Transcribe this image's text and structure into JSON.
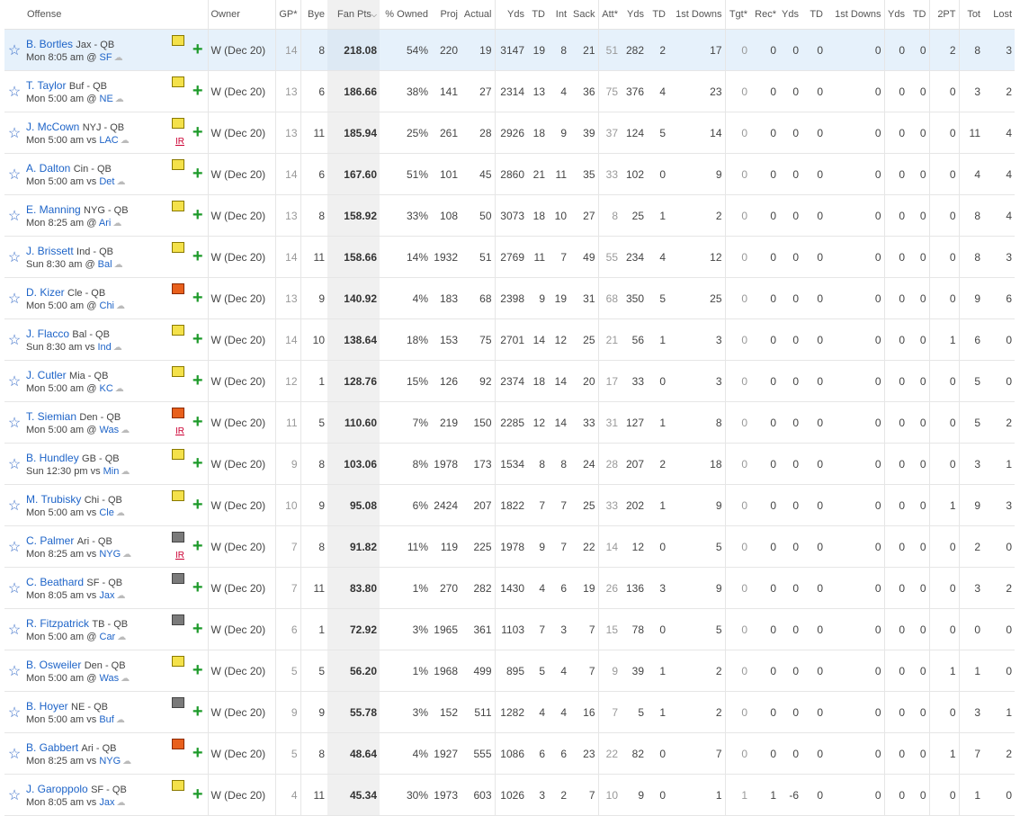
{
  "headers": {
    "offense": "Offense",
    "owner": "Owner",
    "gp": "GP*",
    "bye": "Bye",
    "fan_pts": "Fan Pts",
    "owned": "% Owned",
    "proj": "Proj",
    "actual": "Actual",
    "pass_yds": "Yds",
    "pass_td": "TD",
    "int": "Int",
    "sack": "Sack",
    "rush_att": "Att*",
    "rush_yds": "Yds",
    "rush_td": "TD",
    "rush_1st": "1st Downs",
    "tgt": "Tgt*",
    "rec": "Rec*",
    "rec_yds": "Yds",
    "rec_td": "TD",
    "rec_1st": "1st Downs",
    "ret_yds": "Yds",
    "ret_td": "TD",
    "two_pt": "2PT",
    "fum_tot": "Tot",
    "fum_lost": "Lost"
  },
  "players": [
    {
      "name": "B. Bortles",
      "team": "Jax - QB",
      "time": "Mon 8:05 am",
      "at": "@",
      "opp": "SF",
      "note": "yellow",
      "ir": "",
      "owner": "W (Dec 20)",
      "gp": "14",
      "bye": "8",
      "pts": "218.08",
      "owned": "54%",
      "proj": "220",
      "actual": "19",
      "s": [
        "3147",
        "19",
        "8",
        "21",
        "51",
        "282",
        "2",
        "17",
        "0",
        "0",
        "0",
        "0",
        "0",
        "0",
        "0",
        "2",
        "8",
        "3"
      ]
    },
    {
      "name": "T. Taylor",
      "team": "Buf - QB",
      "time": "Mon 5:00 am",
      "at": "@",
      "opp": "NE",
      "note": "yellow",
      "ir": "",
      "owner": "W (Dec 20)",
      "gp": "13",
      "bye": "6",
      "pts": "186.66",
      "owned": "38%",
      "proj": "141",
      "actual": "27",
      "s": [
        "2314",
        "13",
        "4",
        "36",
        "75",
        "376",
        "4",
        "23",
        "0",
        "0",
        "0",
        "0",
        "0",
        "0",
        "0",
        "0",
        "3",
        "2"
      ]
    },
    {
      "name": "J. McCown",
      "team": "NYJ - QB",
      "time": "Mon 5:00 am",
      "at": "vs",
      "opp": "LAC",
      "note": "yellow",
      "ir": "IR",
      "owner": "W (Dec 20)",
      "gp": "13",
      "bye": "11",
      "pts": "185.94",
      "owned": "25%",
      "proj": "261",
      "actual": "28",
      "s": [
        "2926",
        "18",
        "9",
        "39",
        "37",
        "124",
        "5",
        "14",
        "0",
        "0",
        "0",
        "0",
        "0",
        "0",
        "0",
        "0",
        "11",
        "4"
      ]
    },
    {
      "name": "A. Dalton",
      "team": "Cin - QB",
      "time": "Mon 5:00 am",
      "at": "vs",
      "opp": "Det",
      "note": "yellow",
      "ir": "",
      "owner": "W (Dec 20)",
      "gp": "14",
      "bye": "6",
      "pts": "167.60",
      "owned": "51%",
      "proj": "101",
      "actual": "45",
      "s": [
        "2860",
        "21",
        "11",
        "35",
        "33",
        "102",
        "0",
        "9",
        "0",
        "0",
        "0",
        "0",
        "0",
        "0",
        "0",
        "0",
        "4",
        "4"
      ]
    },
    {
      "name": "E. Manning",
      "team": "NYG - QB",
      "time": "Mon 8:25 am",
      "at": "@",
      "opp": "Ari",
      "note": "yellow",
      "ir": "",
      "owner": "W (Dec 20)",
      "gp": "13",
      "bye": "8",
      "pts": "158.92",
      "owned": "33%",
      "proj": "108",
      "actual": "50",
      "s": [
        "3073",
        "18",
        "10",
        "27",
        "8",
        "25",
        "1",
        "2",
        "0",
        "0",
        "0",
        "0",
        "0",
        "0",
        "0",
        "0",
        "8",
        "4"
      ]
    },
    {
      "name": "J. Brissett",
      "team": "Ind - QB",
      "time": "Sun 8:30 am",
      "at": "@",
      "opp": "Bal",
      "note": "yellow",
      "ir": "",
      "owner": "W (Dec 20)",
      "gp": "14",
      "bye": "11",
      "pts": "158.66",
      "owned": "14%",
      "proj": "1932",
      "actual": "51",
      "s": [
        "2769",
        "11",
        "7",
        "49",
        "55",
        "234",
        "4",
        "12",
        "0",
        "0",
        "0",
        "0",
        "0",
        "0",
        "0",
        "0",
        "8",
        "3"
      ]
    },
    {
      "name": "D. Kizer",
      "team": "Cle - QB",
      "time": "Mon 5:00 am",
      "at": "@",
      "opp": "Chi",
      "note": "red",
      "ir": "",
      "owner": "W (Dec 20)",
      "gp": "13",
      "bye": "9",
      "pts": "140.92",
      "owned": "4%",
      "proj": "183",
      "actual": "68",
      "s": [
        "2398",
        "9",
        "19",
        "31",
        "68",
        "350",
        "5",
        "25",
        "0",
        "0",
        "0",
        "0",
        "0",
        "0",
        "0",
        "0",
        "9",
        "6"
      ]
    },
    {
      "name": "J. Flacco",
      "team": "Bal - QB",
      "time": "Sun 8:30 am",
      "at": "vs",
      "opp": "Ind",
      "note": "yellow",
      "ir": "",
      "owner": "W (Dec 20)",
      "gp": "14",
      "bye": "10",
      "pts": "138.64",
      "owned": "18%",
      "proj": "153",
      "actual": "75",
      "s": [
        "2701",
        "14",
        "12",
        "25",
        "21",
        "56",
        "1",
        "3",
        "0",
        "0",
        "0",
        "0",
        "0",
        "0",
        "0",
        "1",
        "6",
        "0"
      ]
    },
    {
      "name": "J. Cutler",
      "team": "Mia - QB",
      "time": "Mon 5:00 am",
      "at": "@",
      "opp": "KC",
      "note": "yellow",
      "ir": "",
      "owner": "W (Dec 20)",
      "gp": "12",
      "bye": "1",
      "pts": "128.76",
      "owned": "15%",
      "proj": "126",
      "actual": "92",
      "s": [
        "2374",
        "18",
        "14",
        "20",
        "17",
        "33",
        "0",
        "3",
        "0",
        "0",
        "0",
        "0",
        "0",
        "0",
        "0",
        "0",
        "5",
        "0"
      ]
    },
    {
      "name": "T. Siemian",
      "team": "Den - QB",
      "time": "Mon 5:00 am",
      "at": "@",
      "opp": "Was",
      "note": "red",
      "ir": "IR",
      "owner": "W (Dec 20)",
      "gp": "11",
      "bye": "5",
      "pts": "110.60",
      "owned": "7%",
      "proj": "219",
      "actual": "150",
      "s": [
        "2285",
        "12",
        "14",
        "33",
        "31",
        "127",
        "1",
        "8",
        "0",
        "0",
        "0",
        "0",
        "0",
        "0",
        "0",
        "0",
        "5",
        "2"
      ]
    },
    {
      "name": "B. Hundley",
      "team": "GB - QB",
      "time": "Sun 12:30 pm",
      "at": "vs",
      "opp": "Min",
      "note": "yellow",
      "ir": "",
      "owner": "W (Dec 20)",
      "gp": "9",
      "bye": "8",
      "pts": "103.06",
      "owned": "8%",
      "proj": "1978",
      "actual": "173",
      "s": [
        "1534",
        "8",
        "8",
        "24",
        "28",
        "207",
        "2",
        "18",
        "0",
        "0",
        "0",
        "0",
        "0",
        "0",
        "0",
        "0",
        "3",
        "1"
      ]
    },
    {
      "name": "M. Trubisky",
      "team": "Chi - QB",
      "time": "Mon 5:00 am",
      "at": "vs",
      "opp": "Cle",
      "note": "yellow",
      "ir": "",
      "owner": "W (Dec 20)",
      "gp": "10",
      "bye": "9",
      "pts": "95.08",
      "owned": "6%",
      "proj": "2424",
      "actual": "207",
      "s": [
        "1822",
        "7",
        "7",
        "25",
        "33",
        "202",
        "1",
        "9",
        "0",
        "0",
        "0",
        "0",
        "0",
        "0",
        "0",
        "1",
        "9",
        "3"
      ]
    },
    {
      "name": "C. Palmer",
      "team": "Ari - QB",
      "time": "Mon 8:25 am",
      "at": "vs",
      "opp": "NYG",
      "note": "grey",
      "ir": "IR",
      "owner": "W (Dec 20)",
      "gp": "7",
      "bye": "8",
      "pts": "91.82",
      "owned": "11%",
      "proj": "119",
      "actual": "225",
      "s": [
        "1978",
        "9",
        "7",
        "22",
        "14",
        "12",
        "0",
        "5",
        "0",
        "0",
        "0",
        "0",
        "0",
        "0",
        "0",
        "0",
        "2",
        "0"
      ]
    },
    {
      "name": "C. Beathard",
      "team": "SF - QB",
      "time": "Mon 8:05 am",
      "at": "vs",
      "opp": "Jax",
      "note": "grey",
      "ir": "",
      "owner": "W (Dec 20)",
      "gp": "7",
      "bye": "11",
      "pts": "83.80",
      "owned": "1%",
      "proj": "270",
      "actual": "282",
      "s": [
        "1430",
        "4",
        "6",
        "19",
        "26",
        "136",
        "3",
        "9",
        "0",
        "0",
        "0",
        "0",
        "0",
        "0",
        "0",
        "0",
        "3",
        "2"
      ]
    },
    {
      "name": "R. Fitzpatrick",
      "team": "TB - QB",
      "time": "Mon 5:00 am",
      "at": "@",
      "opp": "Car",
      "note": "grey",
      "ir": "",
      "owner": "W (Dec 20)",
      "gp": "6",
      "bye": "1",
      "pts": "72.92",
      "owned": "3%",
      "proj": "1965",
      "actual": "361",
      "s": [
        "1103",
        "7",
        "3",
        "7",
        "15",
        "78",
        "0",
        "5",
        "0",
        "0",
        "0",
        "0",
        "0",
        "0",
        "0",
        "0",
        "0",
        "0"
      ]
    },
    {
      "name": "B. Osweiler",
      "team": "Den - QB",
      "time": "Mon 5:00 am",
      "at": "@",
      "opp": "Was",
      "note": "yellow",
      "ir": "",
      "owner": "W (Dec 20)",
      "gp": "5",
      "bye": "5",
      "pts": "56.20",
      "owned": "1%",
      "proj": "1968",
      "actual": "499",
      "s": [
        "895",
        "5",
        "4",
        "7",
        "9",
        "39",
        "1",
        "2",
        "0",
        "0",
        "0",
        "0",
        "0",
        "0",
        "0",
        "1",
        "1",
        "0"
      ]
    },
    {
      "name": "B. Hoyer",
      "team": "NE - QB",
      "time": "Mon 5:00 am",
      "at": "vs",
      "opp": "Buf",
      "note": "grey",
      "ir": "",
      "owner": "W (Dec 20)",
      "gp": "9",
      "bye": "9",
      "pts": "55.78",
      "owned": "3%",
      "proj": "152",
      "actual": "511",
      "s": [
        "1282",
        "4",
        "4",
        "16",
        "7",
        "5",
        "1",
        "2",
        "0",
        "0",
        "0",
        "0",
        "0",
        "0",
        "0",
        "0",
        "3",
        "1"
      ]
    },
    {
      "name": "B. Gabbert",
      "team": "Ari - QB",
      "time": "Mon 8:25 am",
      "at": "vs",
      "opp": "NYG",
      "note": "red",
      "ir": "",
      "owner": "W (Dec 20)",
      "gp": "5",
      "bye": "8",
      "pts": "48.64",
      "owned": "4%",
      "proj": "1927",
      "actual": "555",
      "s": [
        "1086",
        "6",
        "6",
        "23",
        "22",
        "82",
        "0",
        "7",
        "0",
        "0",
        "0",
        "0",
        "0",
        "0",
        "0",
        "1",
        "7",
        "2"
      ]
    },
    {
      "name": "J. Garoppolo",
      "team": "SF - QB",
      "time": "Mon 8:05 am",
      "at": "vs",
      "opp": "Jax",
      "note": "yellow",
      "ir": "",
      "owner": "W (Dec 20)",
      "gp": "4",
      "bye": "11",
      "pts": "45.34",
      "owned": "30%",
      "proj": "1973",
      "actual": "603",
      "s": [
        "1026",
        "3",
        "2",
        "7",
        "10",
        "9",
        "0",
        "1",
        "1",
        "1",
        "-6",
        "0",
        "0",
        "0",
        "0",
        "0",
        "1",
        "0"
      ]
    }
  ]
}
